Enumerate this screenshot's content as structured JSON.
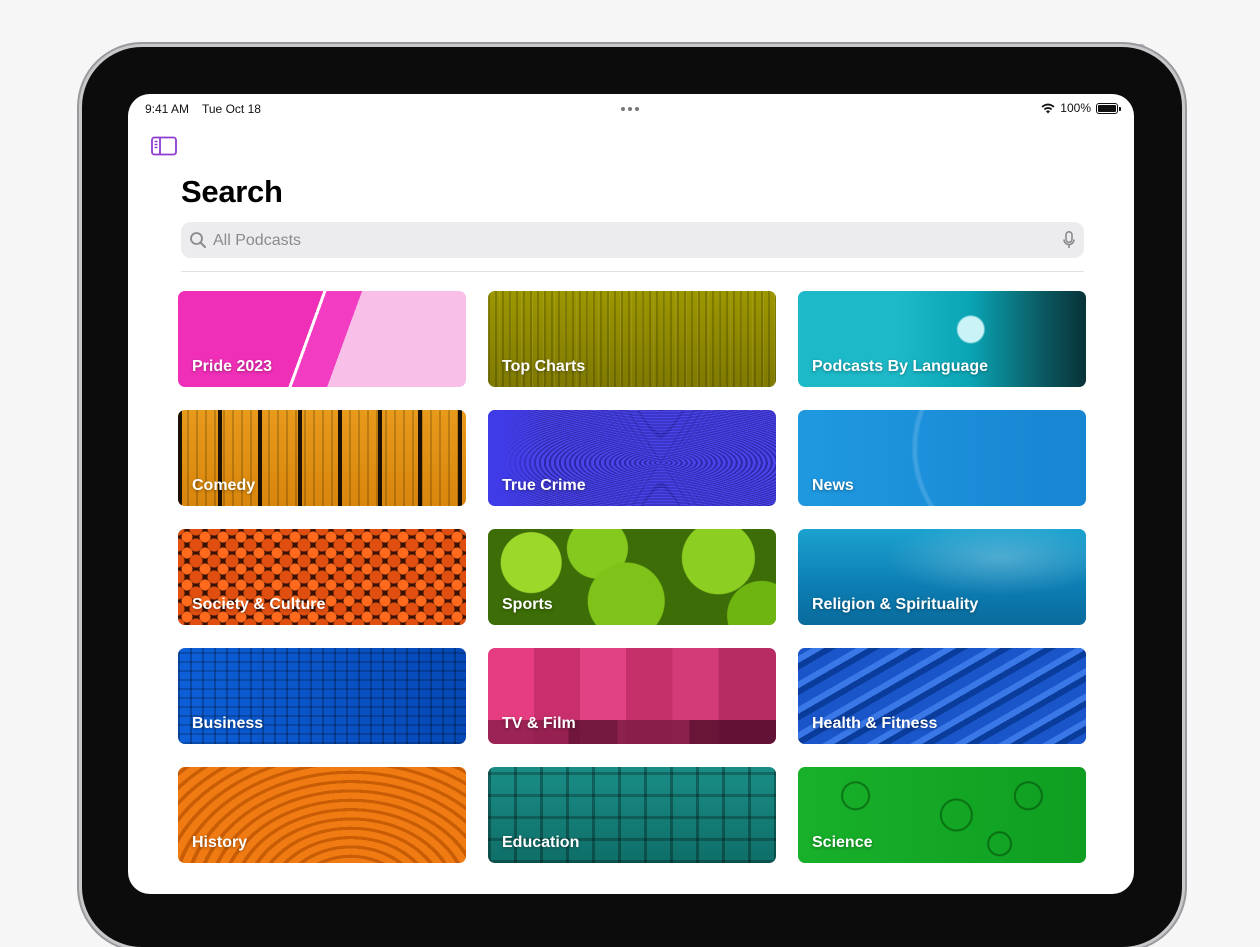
{
  "status_bar": {
    "time": "9:41 AM",
    "date": "Tue Oct 18",
    "battery": "100%"
  },
  "page": {
    "title": "Search"
  },
  "search": {
    "placeholder": "All Podcasts"
  },
  "categories": [
    {
      "label": "Pride 2023",
      "color": "#f02fb8"
    },
    {
      "label": "Top Charts",
      "color": "#9d9700"
    },
    {
      "label": "Podcasts By Language",
      "color": "#1db9c8"
    },
    {
      "label": "Comedy",
      "color": "#e89a1b"
    },
    {
      "label": "True Crime",
      "color": "#4a44e8"
    },
    {
      "label": "News",
      "color": "#1f99e0"
    },
    {
      "label": "Society & Culture",
      "color": "#e04e10"
    },
    {
      "label": "Sports",
      "color": "#8ccf22"
    },
    {
      "label": "Religion & Spirituality",
      "color": "#1ba2cf"
    },
    {
      "label": "Business",
      "color": "#0d5fd8"
    },
    {
      "label": "TV & Film",
      "color": "#e63c81"
    },
    {
      "label": "Health & Fitness",
      "color": "#1a56c9"
    },
    {
      "label": "History",
      "color": "#e57110"
    },
    {
      "label": "Education",
      "color": "#1a8d86"
    },
    {
      "label": "Science",
      "color": "#18b02a"
    }
  ],
  "icons": {
    "sidebar": "sidebar-icon",
    "search": "search-icon",
    "mic": "microphone-icon",
    "wifi": "wifi-icon",
    "battery": "battery-icon"
  },
  "accent_color": "#8e3bd1"
}
